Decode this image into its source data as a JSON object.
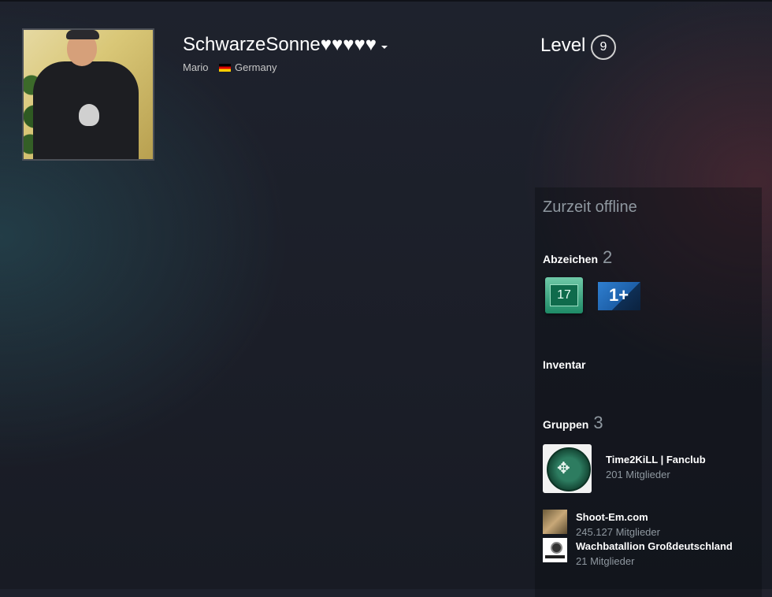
{
  "profile": {
    "persona_name": "SchwarzeSonne♥♥♥♥♥",
    "real_name": "Mario",
    "country": "Germany",
    "level_label": "Level",
    "level_value": "9"
  },
  "sidebar": {
    "status": "Zurzeit offline",
    "badges": {
      "title": "Abzeichen",
      "count": "2",
      "items": [
        {
          "icon": "years-of-service-badge-icon",
          "text": "17"
        },
        {
          "icon": "community-badge-icon",
          "text": "1+"
        }
      ]
    },
    "inventory": {
      "title": "Inventar"
    },
    "groups": {
      "title": "Gruppen",
      "count": "3",
      "items": [
        {
          "name": "Time2KiLL | Fanclub",
          "members": "201 Mitglieder"
        },
        {
          "name": "Shoot-Em.com",
          "members": "245.127 Mitglieder"
        },
        {
          "name": "Wachbatallion Großdeutschland",
          "members": "21 Mitglieder"
        }
      ]
    }
  },
  "colors": {
    "muted_text": "#8f98a0",
    "background": "#1b1e28"
  }
}
